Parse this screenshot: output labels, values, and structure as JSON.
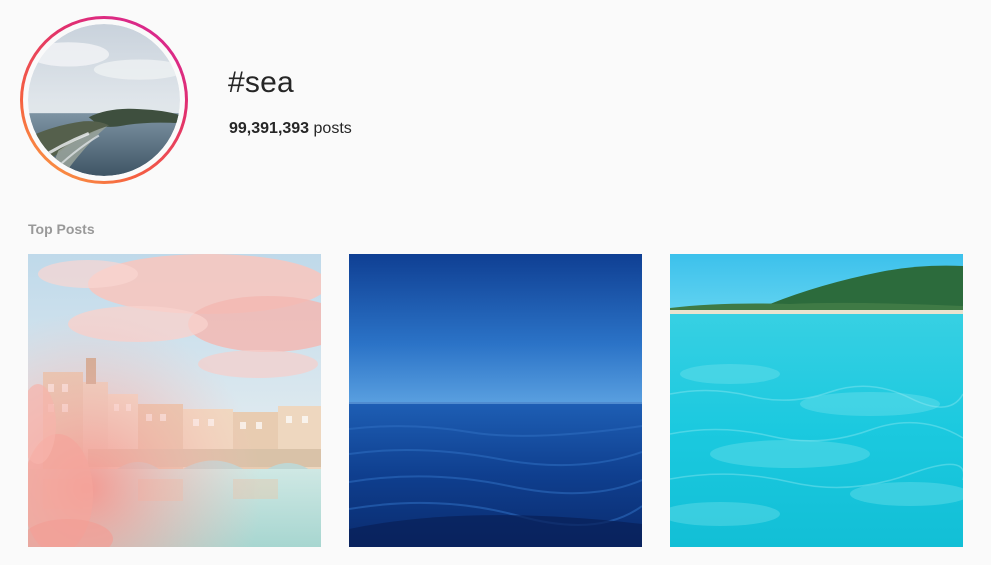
{
  "hashtag": {
    "title": "#sea",
    "post_count": "99,391,393",
    "post_count_suffix": "posts",
    "avatar_alt": "#sea"
  },
  "sections": {
    "top_posts_label": "Top Posts"
  },
  "top_posts": [
    {
      "name": "post-florence-bridge"
    },
    {
      "name": "post-deep-blue-sea"
    },
    {
      "name": "post-turquoise-water"
    }
  ],
  "colors": {
    "ring_gradient": [
      "#d6249f",
      "#e1306c",
      "#f56040",
      "#fcaf45"
    ],
    "background": "#fafafa",
    "text": "#262626",
    "muted": "#999999"
  }
}
